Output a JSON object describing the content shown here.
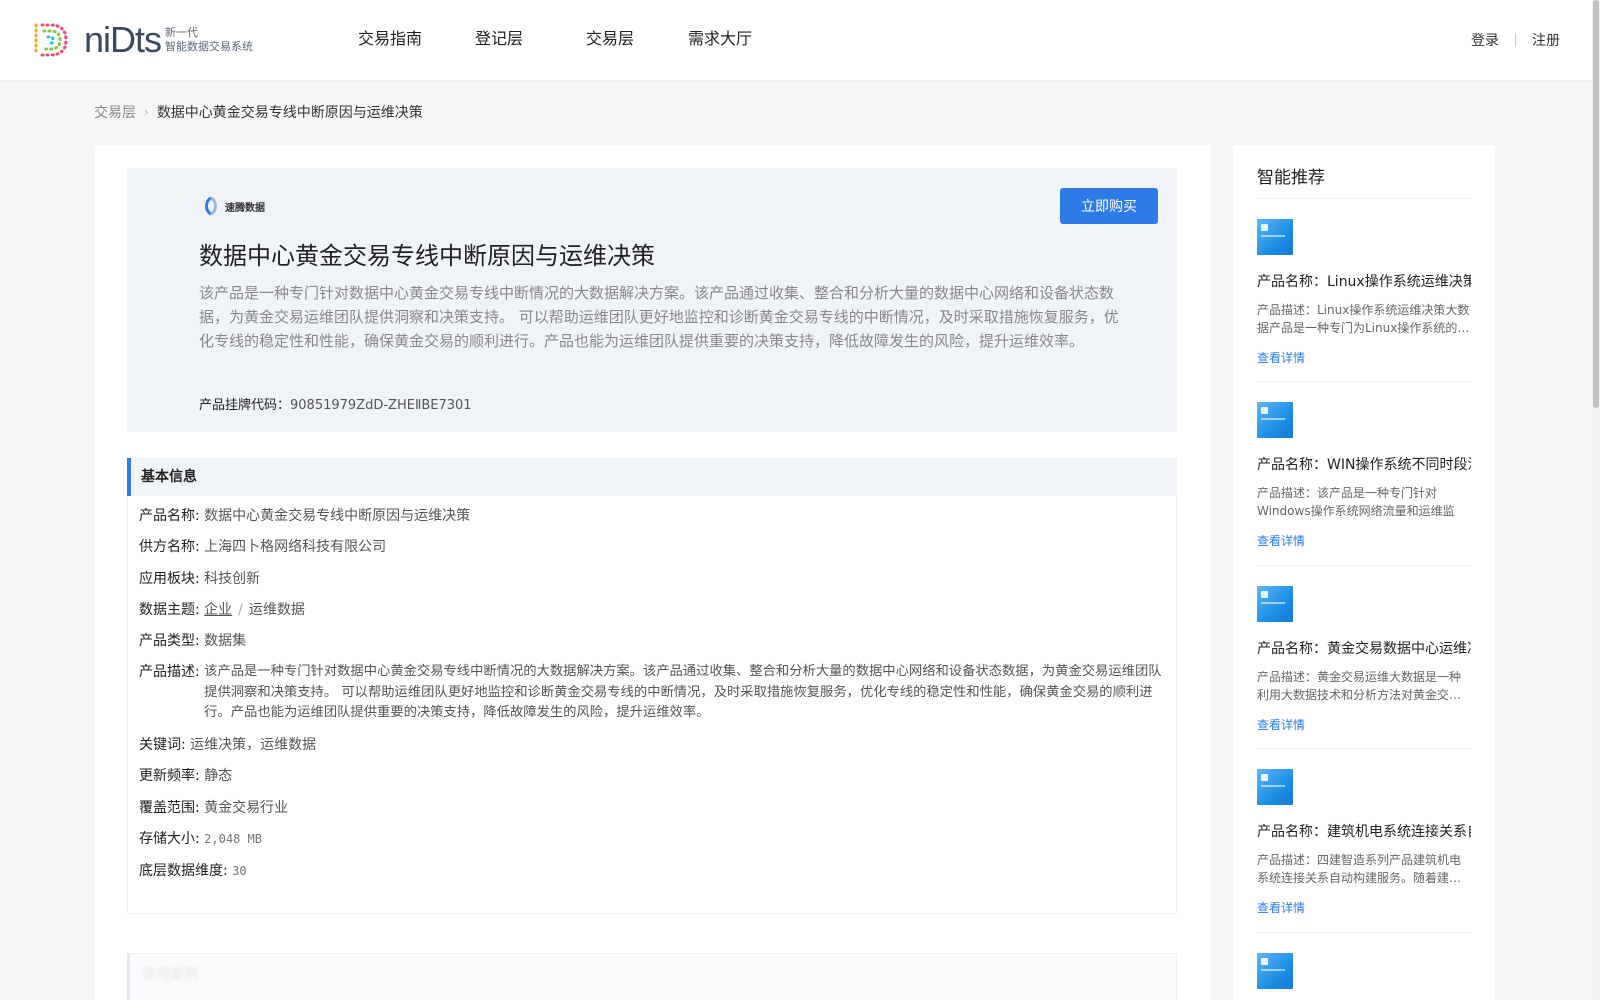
{
  "header": {
    "logo": {
      "word": "niDts",
      "tagline_line1": "新一代",
      "tagline_line2": "智能数据交易系统"
    },
    "nav": [
      "交易指南",
      "登记层",
      "交易层",
      "需求大厅"
    ],
    "login": "登录",
    "register": "注册"
  },
  "breadcrumb": {
    "parent": "交易层",
    "current": "数据中心黄金交易专线中断原因与运维决策"
  },
  "hero": {
    "provider_logo_text": "速腾数据",
    "buy_button": "立即购买",
    "title": "数据中心黄金交易专线中断原因与运维决策",
    "description": "该产品是一种专门针对数据中心黄金交易专线中断情况的大数据解决方案。该产品通过收集、整合和分析大量的数据中心网络和设备状态数据，为黄金交易运维团队提供洞察和决策支持。 可以帮助运维团队更好地监控和诊断黄金交易专线的中断情况，及时采取措施恢复服务，优化专线的稳定性和性能，确保黄金交易的顺利进行。产品也能为运维团队提供重要的决策支持，降低故障发生的风险，提升运维效率。",
    "code_label": "产品挂牌代码：",
    "code_value": "90851979ZdD-ZHEⅡBE7301"
  },
  "basic_info": {
    "title": "基本信息",
    "product_name_label": "产品名称:",
    "product_name": "数据中心黄金交易专线中断原因与运维决策",
    "supplier_label": "供方名称:",
    "supplier": "上海四卜格网络科技有限公司",
    "sector_label": "应用板块:",
    "sector": "科技创新",
    "topic_label": "数据主题:",
    "topic_1": "企业",
    "topic_sep": "/",
    "topic_2": "运维数据",
    "type_label": "产品类型:",
    "type": "数据集",
    "desc_label": "产品描述:",
    "desc": "该产品是一种专门针对数据中心黄金交易专线中断情况的大数据解决方案。该产品通过收集、整合和分析大量的数据中心网络和设备状态数据，为黄金交易运维团队提供洞察和决策支持。 可以帮助运维团队更好地监控和诊断黄金交易专线的中断情况，及时采取措施恢复服务，优化专线的稳定性和性能，确保黄金交易的顺利进行。产品也能为运维团队提供重要的决策支持，降低故障发生的风险，提升运维效率。",
    "keywords_label": "关键词:",
    "keywords": "运维决策，运维数据",
    "frequency_label": "更新频率:",
    "frequency": "静态",
    "coverage_label": "覆盖范围:",
    "coverage": "黄金交易行业",
    "storage_label": "存储大小:",
    "storage": "2,048 MB",
    "dimension_label": "底层数据维度:",
    "dimension": "30"
  },
  "faded_section_title": "使用案例",
  "side": {
    "title": "智能推荐",
    "items": [
      {
        "name": "产品名称：Linux操作系统运维决策",
        "desc": "产品描述：Linux操作系统运维决策大数据产品是一种专门为Linux操作系统的…",
        "link": "查看详情"
      },
      {
        "name": "产品名称：WIN操作系统不同时段流",
        "desc": "产品描述：该产品是一种专门针对Windows操作系统网络流量和运维监控…",
        "link": "查看详情"
      },
      {
        "name": "产品名称：黄金交易数据中心运维决",
        "desc": "产品描述：黄金交易运维大数据是一种利用大数据技术和分析方法对黄金交…",
        "link": "查看详情"
      },
      {
        "name": "产品名称：建筑机电系统连接关系自",
        "desc": "产品描述：四建智造系列产品建筑机电系统连接关系自动构建服务。随着建…",
        "link": "查看详情"
      }
    ]
  }
}
